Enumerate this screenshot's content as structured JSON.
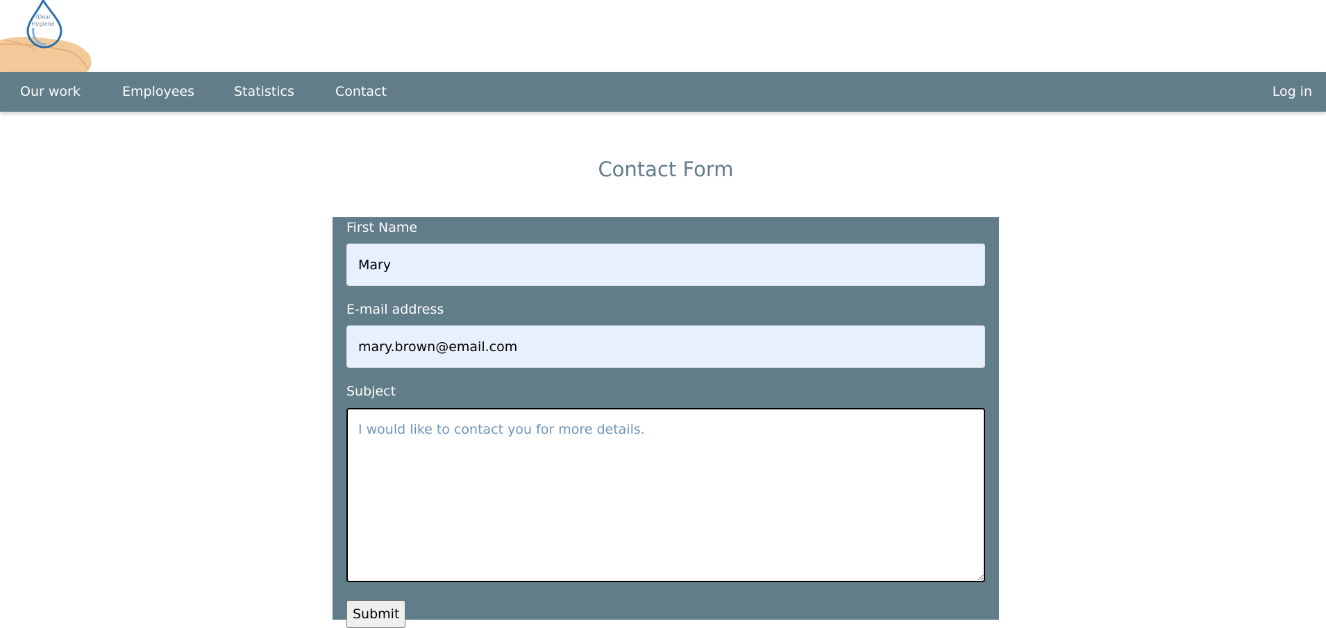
{
  "logo": {
    "text": "IDeal Hygiene",
    "drop_color": "#2d6fb0",
    "hand_color": "#f3c99a"
  },
  "nav": {
    "items": [
      {
        "label": "Our work"
      },
      {
        "label": "Employees"
      },
      {
        "label": "Statistics"
      },
      {
        "label": "Contact"
      }
    ],
    "login_label": "Log in"
  },
  "page": {
    "title": "Contact Form"
  },
  "form": {
    "first_name": {
      "label": "First Name",
      "value": "Mary"
    },
    "email": {
      "label": "E-mail address",
      "value": "mary.brown@email.com"
    },
    "subject": {
      "label": "Subject",
      "value": "I would like to contact you for more details."
    },
    "submit_label": "Submit"
  },
  "colors": {
    "nav_bg": "#627d8a",
    "form_bg": "#627d8a",
    "title_color": "#627d8a",
    "input_bg": "#e8f0fe"
  }
}
